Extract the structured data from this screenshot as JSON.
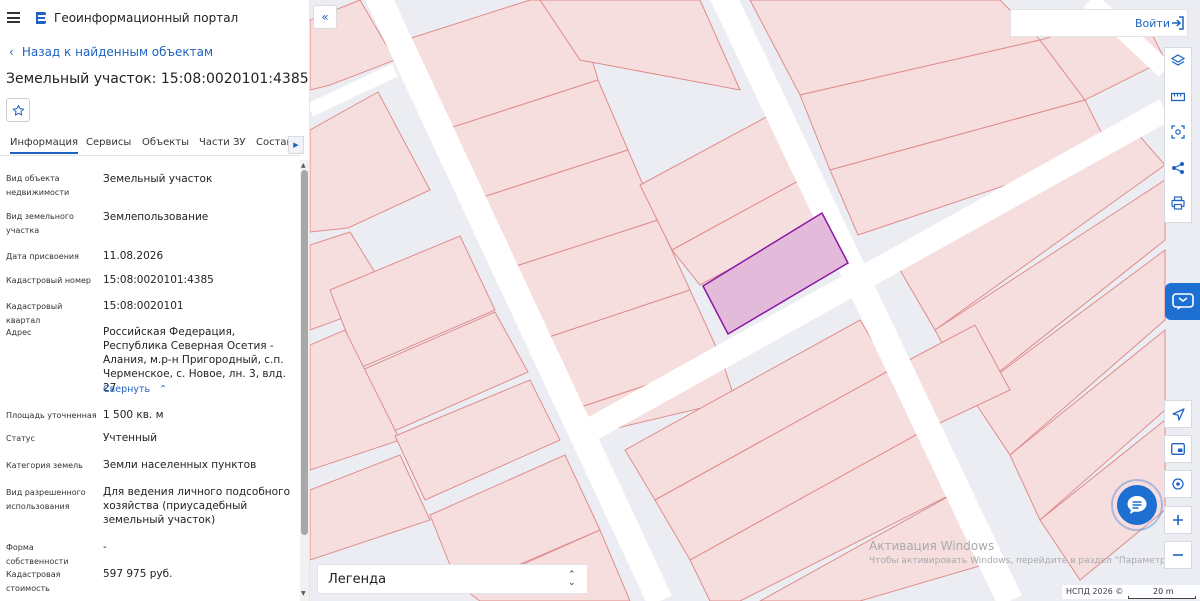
{
  "header": {
    "menu_icon": "hamburger-icon",
    "logo_icon": "portal-logo-icon",
    "title": "Геоинформационный портал"
  },
  "sidebar": {
    "back_link": "Назад к найденным объектам",
    "parcel_title": "Земельный участок: 15:08:0020101:4385",
    "favorite_icon": "star-icon",
    "tabs": [
      {
        "label": "Информация",
        "active": true
      },
      {
        "label": "Сервисы"
      },
      {
        "label": "Объекты"
      },
      {
        "label": "Части ЗУ"
      },
      {
        "label": "Состав"
      }
    ],
    "info": [
      {
        "label": "Вид объекта недвижимости",
        "value": "Земельный участок"
      },
      {
        "label": "Вид земельного участка",
        "value": "Землепользование"
      },
      {
        "label": "Дата присвоения",
        "value": "11.08.2026"
      },
      {
        "label": "Кадастровый номер",
        "value": "15:08:0020101:4385"
      },
      {
        "label": "Кадастровый квартал",
        "value": "15:08:0020101"
      },
      {
        "label": "Адрес",
        "value": "Российская Федерация, Республика Северная Осетия - Алания, м.р-н Пригородный, с.п. Черменское, с. Новое, лн. 3, влд. 27"
      },
      {
        "label": "Площадь уточненная",
        "value": "1 500 кв. м"
      },
      {
        "label": "Статус",
        "value": "Учтенный"
      },
      {
        "label": "Категория земель",
        "value": "Земли населенных пунктов"
      },
      {
        "label": "Вид разрешенного использования",
        "value": "Для ведения личного подсобного хозяйства (приусадебный земельный участок)"
      },
      {
        "label": "Форма собственности",
        "value": "-"
      },
      {
        "label": "Кадастровая стоимость",
        "value": "597 975 руб."
      }
    ],
    "collapse_label": "Свернуть"
  },
  "map": {
    "login_label": "Войти",
    "legend_label": "Легенда",
    "tools_top": [
      "layers-icon",
      "ruler-icon",
      "area-select-icon",
      "share-icon",
      "print-icon"
    ],
    "tools_bottom": [
      "locate-icon",
      "minimap-icon",
      "gps-icon",
      "zoom-in-icon",
      "zoom-out-icon"
    ],
    "chat_icon": "feedback-chat-icon",
    "assistant_icon": "assistant-chat-icon",
    "watermark_title": "Активация Windows",
    "watermark_sub": "Чтобы активировать Windows, перейдите в раздел \"Параметры\".",
    "attribution": "НСПД 2026 ©",
    "scale": "20 m"
  },
  "colors": {
    "accent": "#1e63c4",
    "parcel_fill": "#f7dede",
    "parcel_line": "#e08c8c",
    "selected_fill": "#e3bad9",
    "selected_line": "#8a17a6",
    "road": "#ffffff",
    "background": "#ecedf3"
  }
}
